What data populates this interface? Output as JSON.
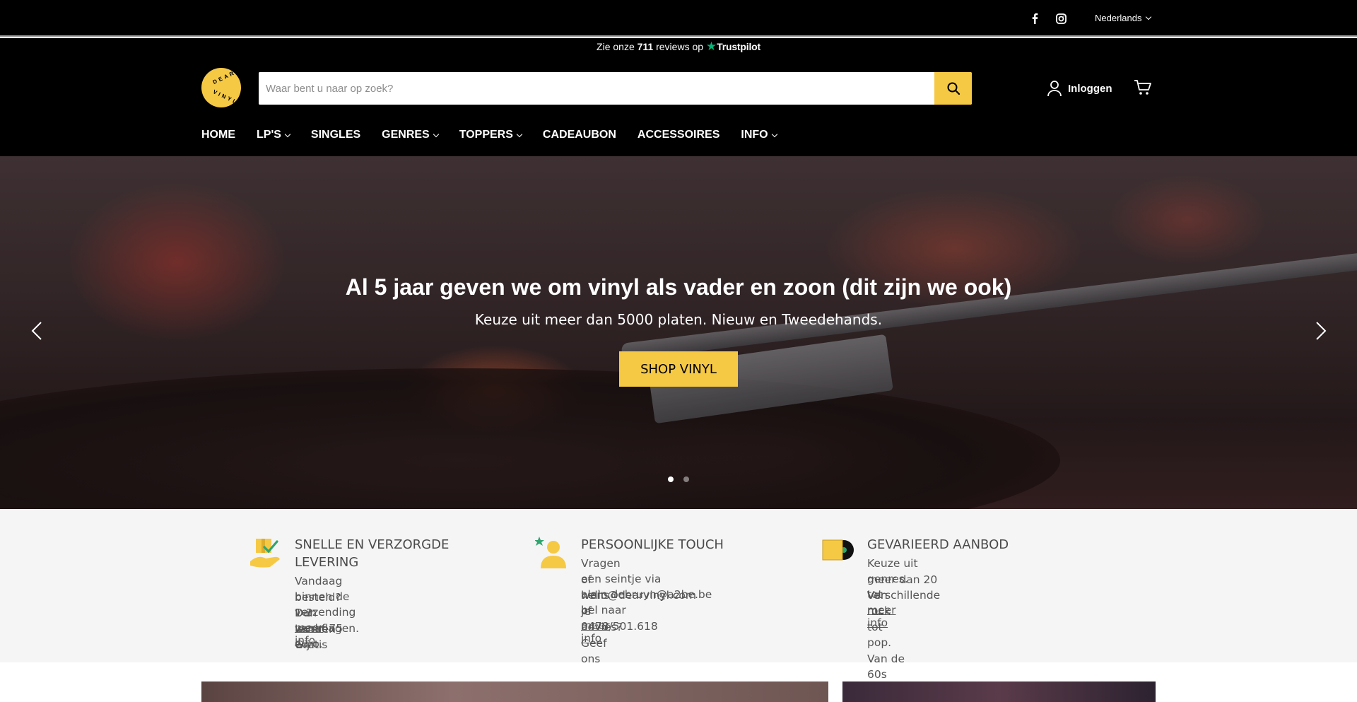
{
  "utility": {
    "social": [
      {
        "name": "facebook-icon",
        "glyph": "f"
      },
      {
        "name": "instagram-icon",
        "glyph": "instagram"
      }
    ],
    "language": "Nederlands"
  },
  "header": {
    "trustpilot": {
      "prefix": "Zie onze",
      "count": "711",
      "suffix": "reviews op",
      "brand": "Trustpilot",
      "star_color": "#00b67a"
    },
    "logo": {
      "top_text": "DEAR",
      "bottom_text": "VINYL",
      "color": "#f6c945"
    },
    "search": {
      "placeholder": "Waar bent u naar op zoek?",
      "value": ""
    },
    "login_label": "Inloggen",
    "nav": [
      {
        "label": "HOME",
        "dropdown": false
      },
      {
        "label": "LP'S",
        "dropdown": true
      },
      {
        "label": "SINGLES",
        "dropdown": false
      },
      {
        "label": "GENRES",
        "dropdown": true
      },
      {
        "label": "TOPPERS",
        "dropdown": true
      },
      {
        "label": "CADEAUBON",
        "dropdown": false
      },
      {
        "label": "ACCESSOIRES",
        "dropdown": false
      },
      {
        "label": "INFO",
        "dropdown": true
      }
    ]
  },
  "hero": {
    "title": "Al 5 jaar geven we om vinyl als vader en zoon (dit zijn we ook)",
    "subtitle": "Keuze uit meer dan 5000 platen. Nieuw en Tweedehands.",
    "button_label": "SHOP VINYL",
    "slides": 2,
    "active_slide": 1
  },
  "features": [
    {
      "icon": "delivery-hand-icon",
      "title": "SNELLE EN VERZORGDE LEVERING",
      "lines": [
        "Vandaag besteld? Dan leveren wij",
        "binnen de 1-3 werkdagen. Gratis",
        "verzending vanaf 75 euro."
      ],
      "link": "meer info"
    },
    {
      "icon": "personal-touch-icon",
      "title": "PERSOONLIJKE TOUCH",
      "lines": [
        "Vragen of wens je advies? Geef ons",
        "een seintje via hello@dearvinyl.com of",
        "alain.debruyn@a2be.be of",
        "bel naar 0478/501.618"
      ],
      "link": "meer info"
    },
    {
      "icon": "vinyl-record-icon",
      "title": "GEVARIEERD AANBOD",
      "lines": [
        "Keuze uit meer dan 20 verschillende",
        "genres. Van rock tot pop. Van de 60s",
        "tot nu."
      ],
      "link": "meer info"
    }
  ],
  "colors": {
    "accent": "#f6c945",
    "header_bg": "#000000",
    "features_bg": "#f5f5f5"
  }
}
